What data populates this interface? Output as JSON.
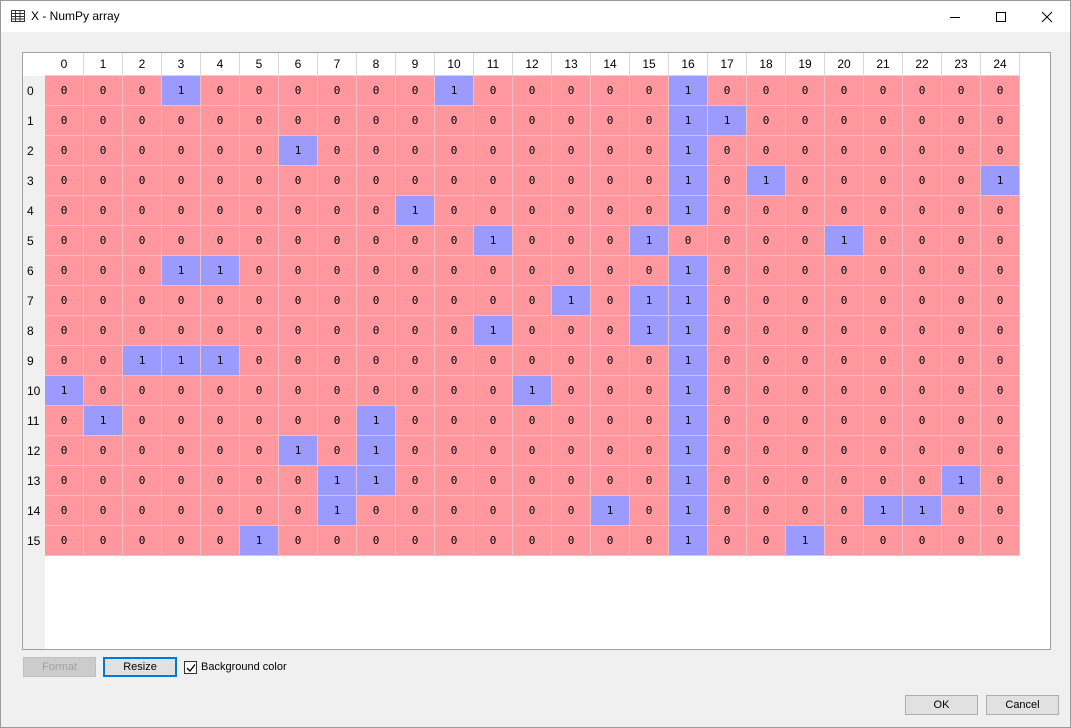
{
  "window": {
    "title": "X - NumPy array",
    "icon": "table-icon",
    "controls": [
      "minimize-icon",
      "maximize-icon",
      "close-icon"
    ]
  },
  "table": {
    "column_headers": [
      "0",
      "1",
      "2",
      "3",
      "4",
      "5",
      "6",
      "7",
      "8",
      "9",
      "10",
      "11",
      "12",
      "13",
      "14",
      "15",
      "16",
      "17",
      "18",
      "19",
      "20",
      "21",
      "22",
      "23",
      "24"
    ],
    "row_headers": [
      "0",
      "1",
      "2",
      "3",
      "4",
      "5",
      "6",
      "7",
      "8",
      "9",
      "10",
      "11",
      "12",
      "13",
      "14",
      "15"
    ],
    "colors": {
      "zero": "#ff979f",
      "one": "#9b9bff"
    },
    "rows": [
      [
        0,
        0,
        0,
        1,
        0,
        0,
        0,
        0,
        0,
        0,
        1,
        0,
        0,
        0,
        0,
        0,
        1,
        0,
        0,
        0,
        0,
        0,
        0,
        0,
        0
      ],
      [
        0,
        0,
        0,
        0,
        0,
        0,
        0,
        0,
        0,
        0,
        0,
        0,
        0,
        0,
        0,
        0,
        1,
        1,
        0,
        0,
        0,
        0,
        0,
        0,
        0
      ],
      [
        0,
        0,
        0,
        0,
        0,
        0,
        1,
        0,
        0,
        0,
        0,
        0,
        0,
        0,
        0,
        0,
        1,
        0,
        0,
        0,
        0,
        0,
        0,
        0,
        0
      ],
      [
        0,
        0,
        0,
        0,
        0,
        0,
        0,
        0,
        0,
        0,
        0,
        0,
        0,
        0,
        0,
        0,
        1,
        0,
        1,
        0,
        0,
        0,
        0,
        0,
        1
      ],
      [
        0,
        0,
        0,
        0,
        0,
        0,
        0,
        0,
        0,
        1,
        0,
        0,
        0,
        0,
        0,
        0,
        1,
        0,
        0,
        0,
        0,
        0,
        0,
        0,
        0
      ],
      [
        0,
        0,
        0,
        0,
        0,
        0,
        0,
        0,
        0,
        0,
        0,
        1,
        0,
        0,
        0,
        1,
        0,
        0,
        0,
        0,
        1,
        0,
        0,
        0,
        0
      ],
      [
        0,
        0,
        0,
        1,
        1,
        0,
        0,
        0,
        0,
        0,
        0,
        0,
        0,
        0,
        0,
        0,
        1,
        0,
        0,
        0,
        0,
        0,
        0,
        0,
        0
      ],
      [
        0,
        0,
        0,
        0,
        0,
        0,
        0,
        0,
        0,
        0,
        0,
        0,
        0,
        1,
        0,
        1,
        1,
        0,
        0,
        0,
        0,
        0,
        0,
        0,
        0
      ],
      [
        0,
        0,
        0,
        0,
        0,
        0,
        0,
        0,
        0,
        0,
        0,
        1,
        0,
        0,
        0,
        1,
        1,
        0,
        0,
        0,
        0,
        0,
        0,
        0,
        0
      ],
      [
        0,
        0,
        1,
        1,
        1,
        0,
        0,
        0,
        0,
        0,
        0,
        0,
        0,
        0,
        0,
        0,
        1,
        0,
        0,
        0,
        0,
        0,
        0,
        0,
        0
      ],
      [
        1,
        0,
        0,
        0,
        0,
        0,
        0,
        0,
        0,
        0,
        0,
        0,
        1,
        0,
        0,
        0,
        1,
        0,
        0,
        0,
        0,
        0,
        0,
        0,
        0
      ],
      [
        0,
        1,
        0,
        0,
        0,
        0,
        0,
        0,
        1,
        0,
        0,
        0,
        0,
        0,
        0,
        0,
        1,
        0,
        0,
        0,
        0,
        0,
        0,
        0,
        0
      ],
      [
        0,
        0,
        0,
        0,
        0,
        0,
        1,
        0,
        1,
        0,
        0,
        0,
        0,
        0,
        0,
        0,
        1,
        0,
        0,
        0,
        0,
        0,
        0,
        0,
        0
      ],
      [
        0,
        0,
        0,
        0,
        0,
        0,
        0,
        1,
        1,
        0,
        0,
        0,
        0,
        0,
        0,
        0,
        1,
        0,
        0,
        0,
        0,
        0,
        0,
        1,
        0
      ],
      [
        0,
        0,
        0,
        0,
        0,
        0,
        0,
        1,
        0,
        0,
        0,
        0,
        0,
        0,
        1,
        0,
        1,
        0,
        0,
        0,
        0,
        1,
        1,
        0,
        0
      ],
      [
        0,
        0,
        0,
        0,
        0,
        1,
        0,
        0,
        0,
        0,
        0,
        0,
        0,
        0,
        0,
        0,
        1,
        0,
        0,
        1,
        0,
        0,
        0,
        0,
        0
      ]
    ]
  },
  "controls": {
    "format_label": "Format",
    "format_enabled": false,
    "resize_label": "Resize",
    "background_color_label": "Background color",
    "background_color_checked": true
  },
  "dialog_buttons": {
    "ok_label": "OK",
    "cancel_label": "Cancel"
  }
}
